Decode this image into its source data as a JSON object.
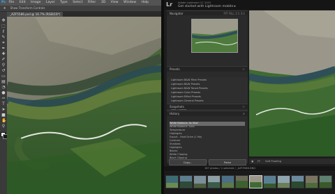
{
  "photoshop": {
    "logo": "Ps",
    "menu": [
      "File",
      "Edit",
      "Image",
      "Layer",
      "Type",
      "Select",
      "Filter",
      "3D",
      "View",
      "Window",
      "Help"
    ],
    "options_text": "Show Transform Controls",
    "tab_title": "_AZF5586.psd @ 16.7% (RGB/16*)"
  },
  "lightroom": {
    "logo": "Lr",
    "small_line": "Adobe Lightroom CC 2015",
    "title": "Get started with Lightroom mobile ▸",
    "navigator_header": "Navigator",
    "navigator_zoom": "FIT  FILL  1:1  3:1",
    "presets_header": "Presets",
    "presets": [
      "Lightroom B&W Filter Presets",
      "Lightroom B&W Presets",
      "Lightroom B&W Toned Presets",
      "Lightroom Color Presets",
      "Lightroom Effect Presets",
      "Lightroom General Presets",
      "Lightroom Video Presets",
      "User Presets"
    ],
    "snapshots_header": "Snapshots",
    "history_header": "History",
    "history": [
      "White Balance: As Shot",
      "White Balance: Auto",
      "Temperature",
      "Highlights",
      "Export - Hard Drive (1 file)",
      "Contrast",
      "Shadows",
      "Highlights",
      "Blacks",
      "White Clipping",
      "Black Clipping"
    ],
    "copy_button": "Copy...",
    "paste_button": "Paste",
    "toolbar_text": "Soft Proofing",
    "status_text": "187 photos / 1 selected / _AZF5586.DNG",
    "colors": {
      "accent_blue": "#31a8ff",
      "selection_gray": "#6b6b6b"
    }
  }
}
